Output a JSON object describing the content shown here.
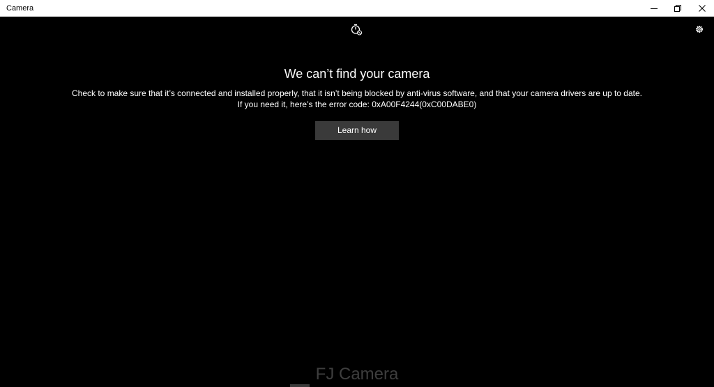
{
  "window": {
    "title": "Camera"
  },
  "toolbar": {
    "timer_icon": "timer-icon",
    "settings_icon": "gear-icon"
  },
  "error": {
    "title": "We can’t find your camera",
    "message_line1": "Check to make sure that it’s connected and installed properly, that it isn’t being blocked by anti-virus software, and that your camera drivers are up to date.",
    "message_line2": "If you need it, here’s the error code: 0xA00F4244(0xC00DABE0)",
    "button_label": "Learn how"
  },
  "watermark": {
    "text": "FJ Camera"
  },
  "colors": {
    "background": "#000000",
    "titlebar": "#ffffff",
    "button": "#3a3a3a",
    "text": "#ffffff",
    "watermark": "#3e3e3e"
  }
}
